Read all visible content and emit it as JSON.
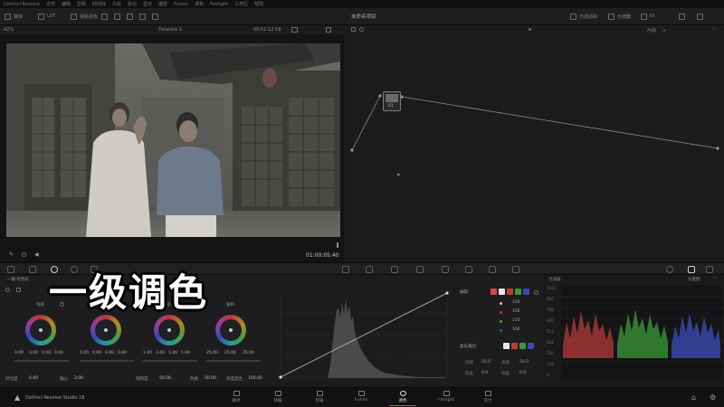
{
  "menubar": {
    "items": [
      "DaVinci Resolve",
      "文件",
      "编辑",
      "剪辑",
      "时间线",
      "片段",
      "标记",
      "显示",
      "播放",
      "Fusion",
      "调色",
      "Fairlight",
      "工作区",
      "帮助"
    ]
  },
  "toolbar": {
    "left_items": [
      "媒体",
      "LUT",
      "视频调色"
    ],
    "center_title": "未命名项目",
    "right_items": [
      "光线追踪",
      "示波器",
      "Kf"
    ]
  },
  "viewer": {
    "zoom": "42%",
    "timeline_name": "Timeline 1",
    "source_timecode": "00:51:12:18",
    "timecode": "01:00:05:40"
  },
  "node_editor": {
    "title": "片段",
    "node_label": "01"
  },
  "caption": "一级调色",
  "wheels": {
    "title": "一级·校色轮",
    "items": [
      {
        "label": "暗部",
        "values": [
          "0.00",
          "0.00",
          "0.00",
          "0.00"
        ]
      },
      {
        "label": "中灰",
        "values": [
          "0.00",
          "0.00",
          "0.00",
          "0.00"
        ]
      },
      {
        "label": "亮部",
        "values": [
          "1.00",
          "1.00",
          "1.00",
          "1.00"
        ]
      },
      {
        "label": "偏移",
        "values": [
          "25.00",
          "25.00",
          "25.00"
        ]
      }
    ],
    "bottom_row": [
      {
        "label": "对比度",
        "value": "0.00"
      },
      {
        "label": "轴心",
        "value": "2.00"
      },
      {
        "label": "饱和度",
        "value": "50.00"
      },
      {
        "label": "色相",
        "value": "50.00"
      },
      {
        "label": "亮度混合",
        "value": "100.00"
      }
    ]
  },
  "curve_side": {
    "title": "编辑",
    "channels": [
      "100",
      "100",
      "100",
      "100"
    ],
    "soft_clip_title": "柔化裁切",
    "soft_clip_rows": [
      {
        "a_label": "低端",
        "a_value": "50.0",
        "b_label": "高端",
        "b_value": "50.0"
      },
      {
        "a_label": "低柔",
        "a_value": "0.0",
        "b_label": "高柔",
        "b_value": "0.0"
      }
    ]
  },
  "scopes": {
    "title": "示波器",
    "mode": "分量图",
    "scale": [
      "1023",
      "896",
      "768",
      "640",
      "512",
      "384",
      "256",
      "128",
      "0"
    ]
  },
  "footer": {
    "app_name": "DaVinci Resolve Studio 18",
    "pages": [
      "媒体",
      "快编",
      "剪辑",
      "Fusion",
      "调色",
      "Fairlight",
      "交付"
    ],
    "active_page": "调色"
  },
  "colors": {
    "accent": "#d64a4a",
    "panel": "#1d1d20"
  }
}
